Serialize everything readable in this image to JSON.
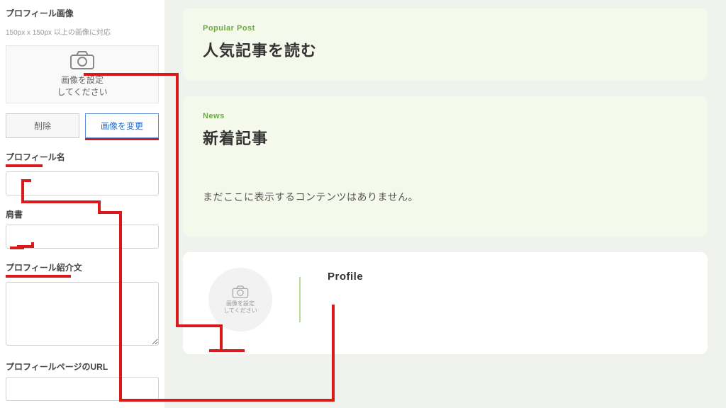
{
  "sidebar": {
    "image_section_title": "プロフィール画像",
    "image_hint": "150px x 150px 以上の画像に対応",
    "upload_line1": "画像を設定",
    "upload_line2": "してください",
    "delete_label": "削除",
    "change_label": "画像を変更",
    "name_label": "プロフィール名",
    "name_value": "",
    "role_label": "肩書",
    "role_value": "",
    "intro_label": "プロフィール紹介文",
    "intro_value": "",
    "url_label": "プロフィールページのURL",
    "url_value": ""
  },
  "main": {
    "popular_eyebrow": "Popular Post",
    "popular_title": "人気記事を読む",
    "news_eyebrow": "News",
    "news_title": "新着記事",
    "news_empty": "まだここに表示するコンテンツはありません。",
    "profile_heading": "Profile",
    "avatar_line1": "画像を設定",
    "avatar_line2": "してください"
  }
}
